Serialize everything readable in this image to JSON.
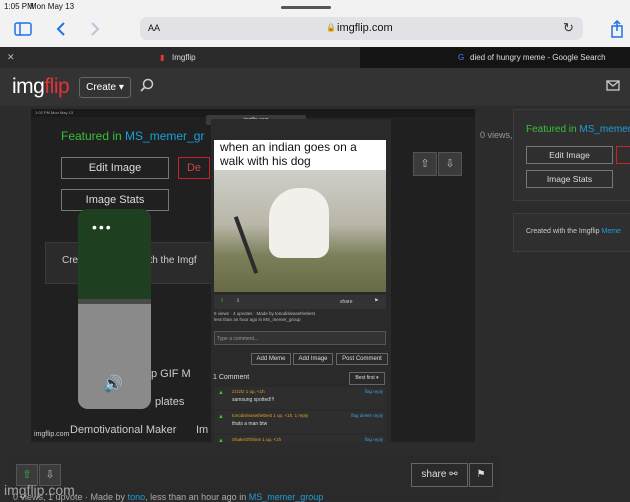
{
  "status_bar": {
    "time": "1:05 PM",
    "date": "Mon May 13"
  },
  "safari": {
    "text_size_label": "AA",
    "url": "imgflip.com",
    "icons": {
      "sidebar": "sidebar-icon",
      "back": "chevron-left-icon",
      "forward": "chevron-right-icon",
      "lock": "lock-icon",
      "reload": "reload-icon",
      "share": "share-icon"
    }
  },
  "tabs": [
    {
      "label": "Imgflip",
      "close": "close-icon"
    },
    {
      "label": "died of hungry meme - Google Search"
    }
  ],
  "header": {
    "logo_img": "img",
    "logo_flip": "flip",
    "create_label": "Create ▾"
  },
  "meme": {
    "small_status": "1:02 PM  Mon May 13",
    "small_url": "imgflip.com",
    "featured_prefix": "Featured in",
    "featured_group": "MS_memer_gr",
    "edit_image": "Edit Image",
    "delete_cut": "De",
    "image_stats": "Image Stats",
    "create_cut": "Cre",
    "create_cut2": "with the Imgf",
    "links": {
      "gif": "p    GIF M",
      "templates": "plates",
      "demotivational": "Demotivational Maker",
      "im": "Im"
    },
    "corner": "imgflip.com",
    "phone": {
      "caption": "when an indian goes on a walk with his dog",
      "share": "share",
      "views_line": "5 views · 4 upvotes · Made by tonodisleasethebest",
      "time_line": "less than an hour ago in MS_memer_group",
      "comment_placeholder": "Type a comment...",
      "add_meme": "Add Meme",
      "add_image": "Add Image",
      "post_comment": "Post Comment",
      "comments_heading": "1 Comment",
      "best_first": "Best first ▾",
      "comments": [
        {
          "name": "zzzztz  1 up, <1h",
          "text": "samsung spotted!!!",
          "reply": "flag reply"
        },
        {
          "name": "tonodisleasethebest  1 up, <1h, 1 reply",
          "text": "thats a man btw",
          "reply": "flag delete reply"
        },
        {
          "name": "ShakeOfShine  1 up, <1h",
          "text": "",
          "reply": "flag reply"
        }
      ]
    }
  },
  "side_panel": {
    "views": "0 views, 1 upvot",
    "featured_prefix": "Featured in",
    "featured_group": "MS_memer",
    "edit_image": "Edit Image",
    "image_stats": "Image Stats",
    "created_with": "Created with the Imgflip",
    "created_with_link": "Meme"
  },
  "bottom": {
    "share": "share",
    "meta_prefix": "0 views, 1 upvote · Made by",
    "author": "tono",
    "meta_mid": "less than an hour ago in",
    "group": "MS_memer_group",
    "watermark": "imgflip.com"
  }
}
